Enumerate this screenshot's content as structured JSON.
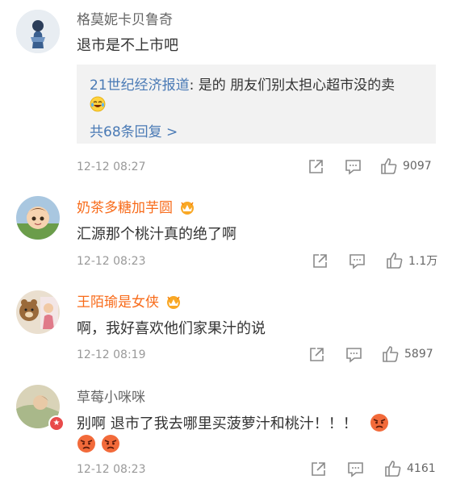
{
  "comments": [
    {
      "username": "格莫妮卡贝鲁奇",
      "text": "退市是不上市吧",
      "reply": {
        "user": "21世纪经济报道",
        "separator": ":",
        "text": " 是的 朋友们别太担心超市没的卖",
        "emoji": "laughing-tears-emoji",
        "more": "共68条回复 >"
      },
      "time": "12-12 08:27",
      "likes": "9097"
    },
    {
      "username": "奶茶多糖加芋圆",
      "vip": true,
      "text": "汇源那个桃汁真的绝了啊",
      "time": "12-12 08:23",
      "likes": "1.1万"
    },
    {
      "username": "王陌瑜是女侠",
      "vip": true,
      "text": "啊，我好喜欢他们家果汁的说",
      "time": "12-12 08:19",
      "likes": "5897"
    },
    {
      "username": "草莓小咪咪",
      "text": "别啊 退市了我去哪里买菠萝汁和桃汁！！！",
      "emojis": [
        "angry-face-emoji",
        "angry-face-emoji",
        "angry-face-emoji"
      ],
      "time": "12-12 08:23",
      "likes": "4161"
    }
  ],
  "icons": {
    "share": "share-icon",
    "comment": "comment-icon",
    "like": "thumbs-up-icon"
  },
  "colors": {
    "vip_name": "#f86b1a",
    "link": "#4a7ab5",
    "reply_bg": "#f2f2f2"
  }
}
